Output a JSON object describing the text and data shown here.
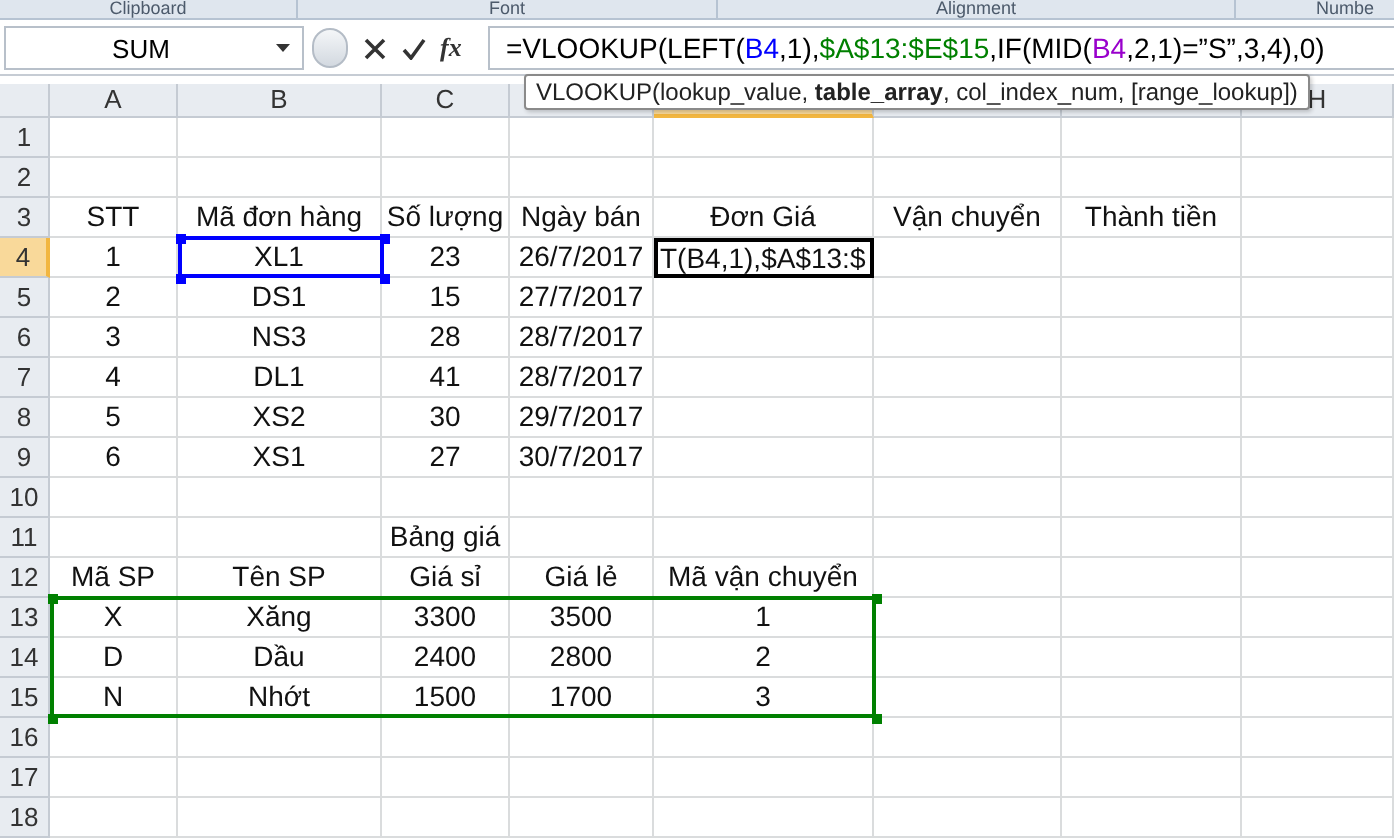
{
  "ribbon_groups": [
    {
      "label": "Clipboard"
    },
    {
      "label": "Font"
    },
    {
      "label": "Alignment"
    },
    {
      "label": "Numbe"
    }
  ],
  "formula_bar": {
    "name_box": "SUM",
    "function_button": "fx",
    "formula_parts": [
      {
        "text": "=VLOOKUP(LEFT(",
        "color": "#000000"
      },
      {
        "text": "B4",
        "color": "#0000ff"
      },
      {
        "text": ",1),",
        "color": "#000000"
      },
      {
        "text": "$A$13:$E$15",
        "color": "#008000"
      },
      {
        "text": ",IF(MID(",
        "color": "#000000"
      },
      {
        "text": "B4",
        "color": "#9900cc"
      },
      {
        "text": ",2,1)=”S”,3,4),0)",
        "color": "#000000"
      }
    ]
  },
  "tooltip": "VLOOKUP(lookup_value, **table_array**, col_index_num, [range_lookup])",
  "columns": [
    {
      "label": "A",
      "selected": false
    },
    {
      "label": "B",
      "selected": false
    },
    {
      "label": "C",
      "selected": false
    },
    {
      "selected": false
    },
    {
      "selected": true
    },
    {
      "selected": false
    },
    {
      "selected": false
    },
    {
      "label": "H",
      "selected": false
    }
  ],
  "rows": [
    {
      "header": "1",
      "selected": false,
      "cells": []
    },
    {
      "header": "2",
      "selected": false,
      "cells": []
    },
    {
      "header": "3",
      "selected": false,
      "cells": [
        "STT",
        "Mã đơn hàng",
        "Số lượng",
        "Ngày bán",
        "Đơn Giá",
        "Vận chuyển",
        "Thành tiền"
      ]
    },
    {
      "header": "4",
      "selected": true,
      "cells": [
        "1",
        "XL1",
        "23",
        "26/7/2017",
        {
          "text": "T(B4,1),$A$13:$",
          "active": true
        }
      ]
    },
    {
      "header": "5",
      "selected": false,
      "cells": [
        "2",
        "DS1",
        "15",
        "27/7/2017"
      ]
    },
    {
      "header": "6",
      "selected": false,
      "cells": [
        "3",
        "NS3",
        "28",
        "28/7/2017"
      ]
    },
    {
      "header": "7",
      "selected": false,
      "cells": [
        "4",
        "DL1",
        "41",
        "28/7/2017"
      ]
    },
    {
      "header": "8",
      "selected": false,
      "cells": [
        "5",
        "XS2",
        "30",
        "29/7/2017"
      ]
    },
    {
      "header": "9",
      "selected": false,
      "cells": [
        "6",
        "XS1",
        "27",
        "30/7/2017"
      ]
    },
    {
      "header": "10",
      "selected": false,
      "cells": []
    },
    {
      "header": "11",
      "selected": false,
      "cells": [
        null,
        null,
        "Bảng giá"
      ]
    },
    {
      "header": "12",
      "selected": false,
      "cells": [
        "Mã SP",
        "Tên SP",
        "Giá sỉ",
        "Giá lẻ",
        "Mã vận chuyển"
      ]
    },
    {
      "header": "13",
      "selected": false,
      "cells": [
        "X",
        "Xăng",
        "3300",
        "3500",
        "1"
      ]
    },
    {
      "header": "14",
      "selected": false,
      "cells": [
        "D",
        "Dầu",
        "2400",
        "2800",
        "2"
      ]
    },
    {
      "header": "15",
      "selected": false,
      "cells": [
        "N",
        "Nhớt",
        "1500",
        "1700",
        "3"
      ]
    },
    {
      "header": "16",
      "selected": false,
      "cells": []
    },
    {
      "header": "17",
      "selected": false,
      "cells": []
    },
    {
      "header": "18",
      "selected": false,
      "cells": []
    }
  ]
}
